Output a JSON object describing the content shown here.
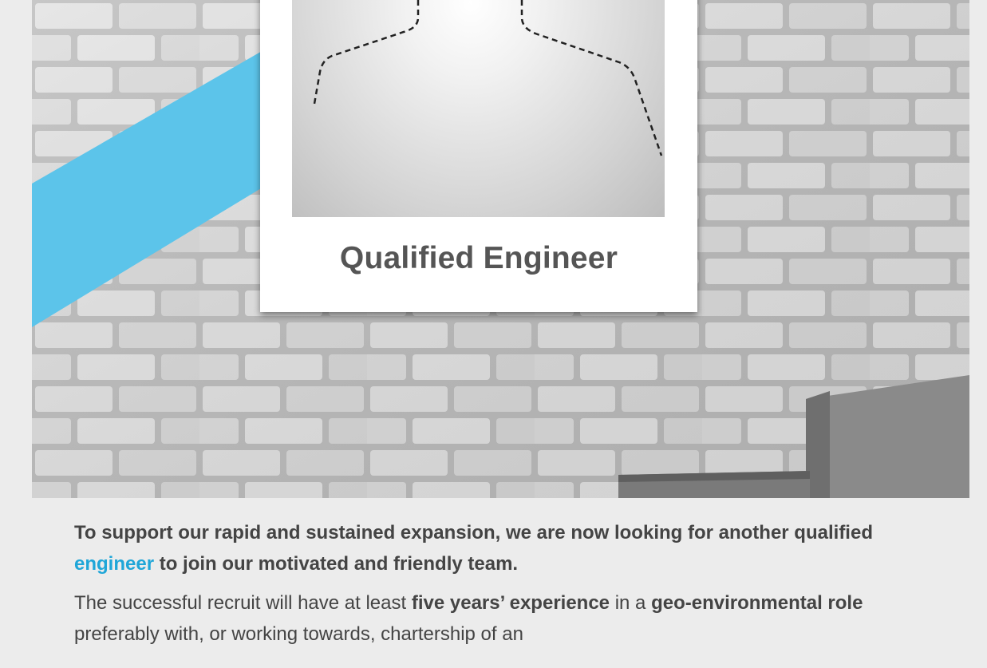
{
  "card": {
    "title": "Qualified Engineer"
  },
  "intro": {
    "before_link": "To support our rapid and sustained expansion, we are now looking for another qualified ",
    "link_text": "engineer",
    "after_link": " to join our motivated and friendly team."
  },
  "details": {
    "t1": "The successful recruit will have at least ",
    "b1": "five years’ experience",
    "t2": " in a ",
    "b2": "geo-environmental role",
    "t3": " preferably with, or working towards, chartership of an"
  },
  "colors": {
    "accent": "#1fa6d8",
    "stripe": "#5cc4ea",
    "text": "#444444",
    "card_title": "#555555",
    "background": "#ececec"
  },
  "icons": {
    "avatar_placeholder": "person-silhouette-icon"
  }
}
